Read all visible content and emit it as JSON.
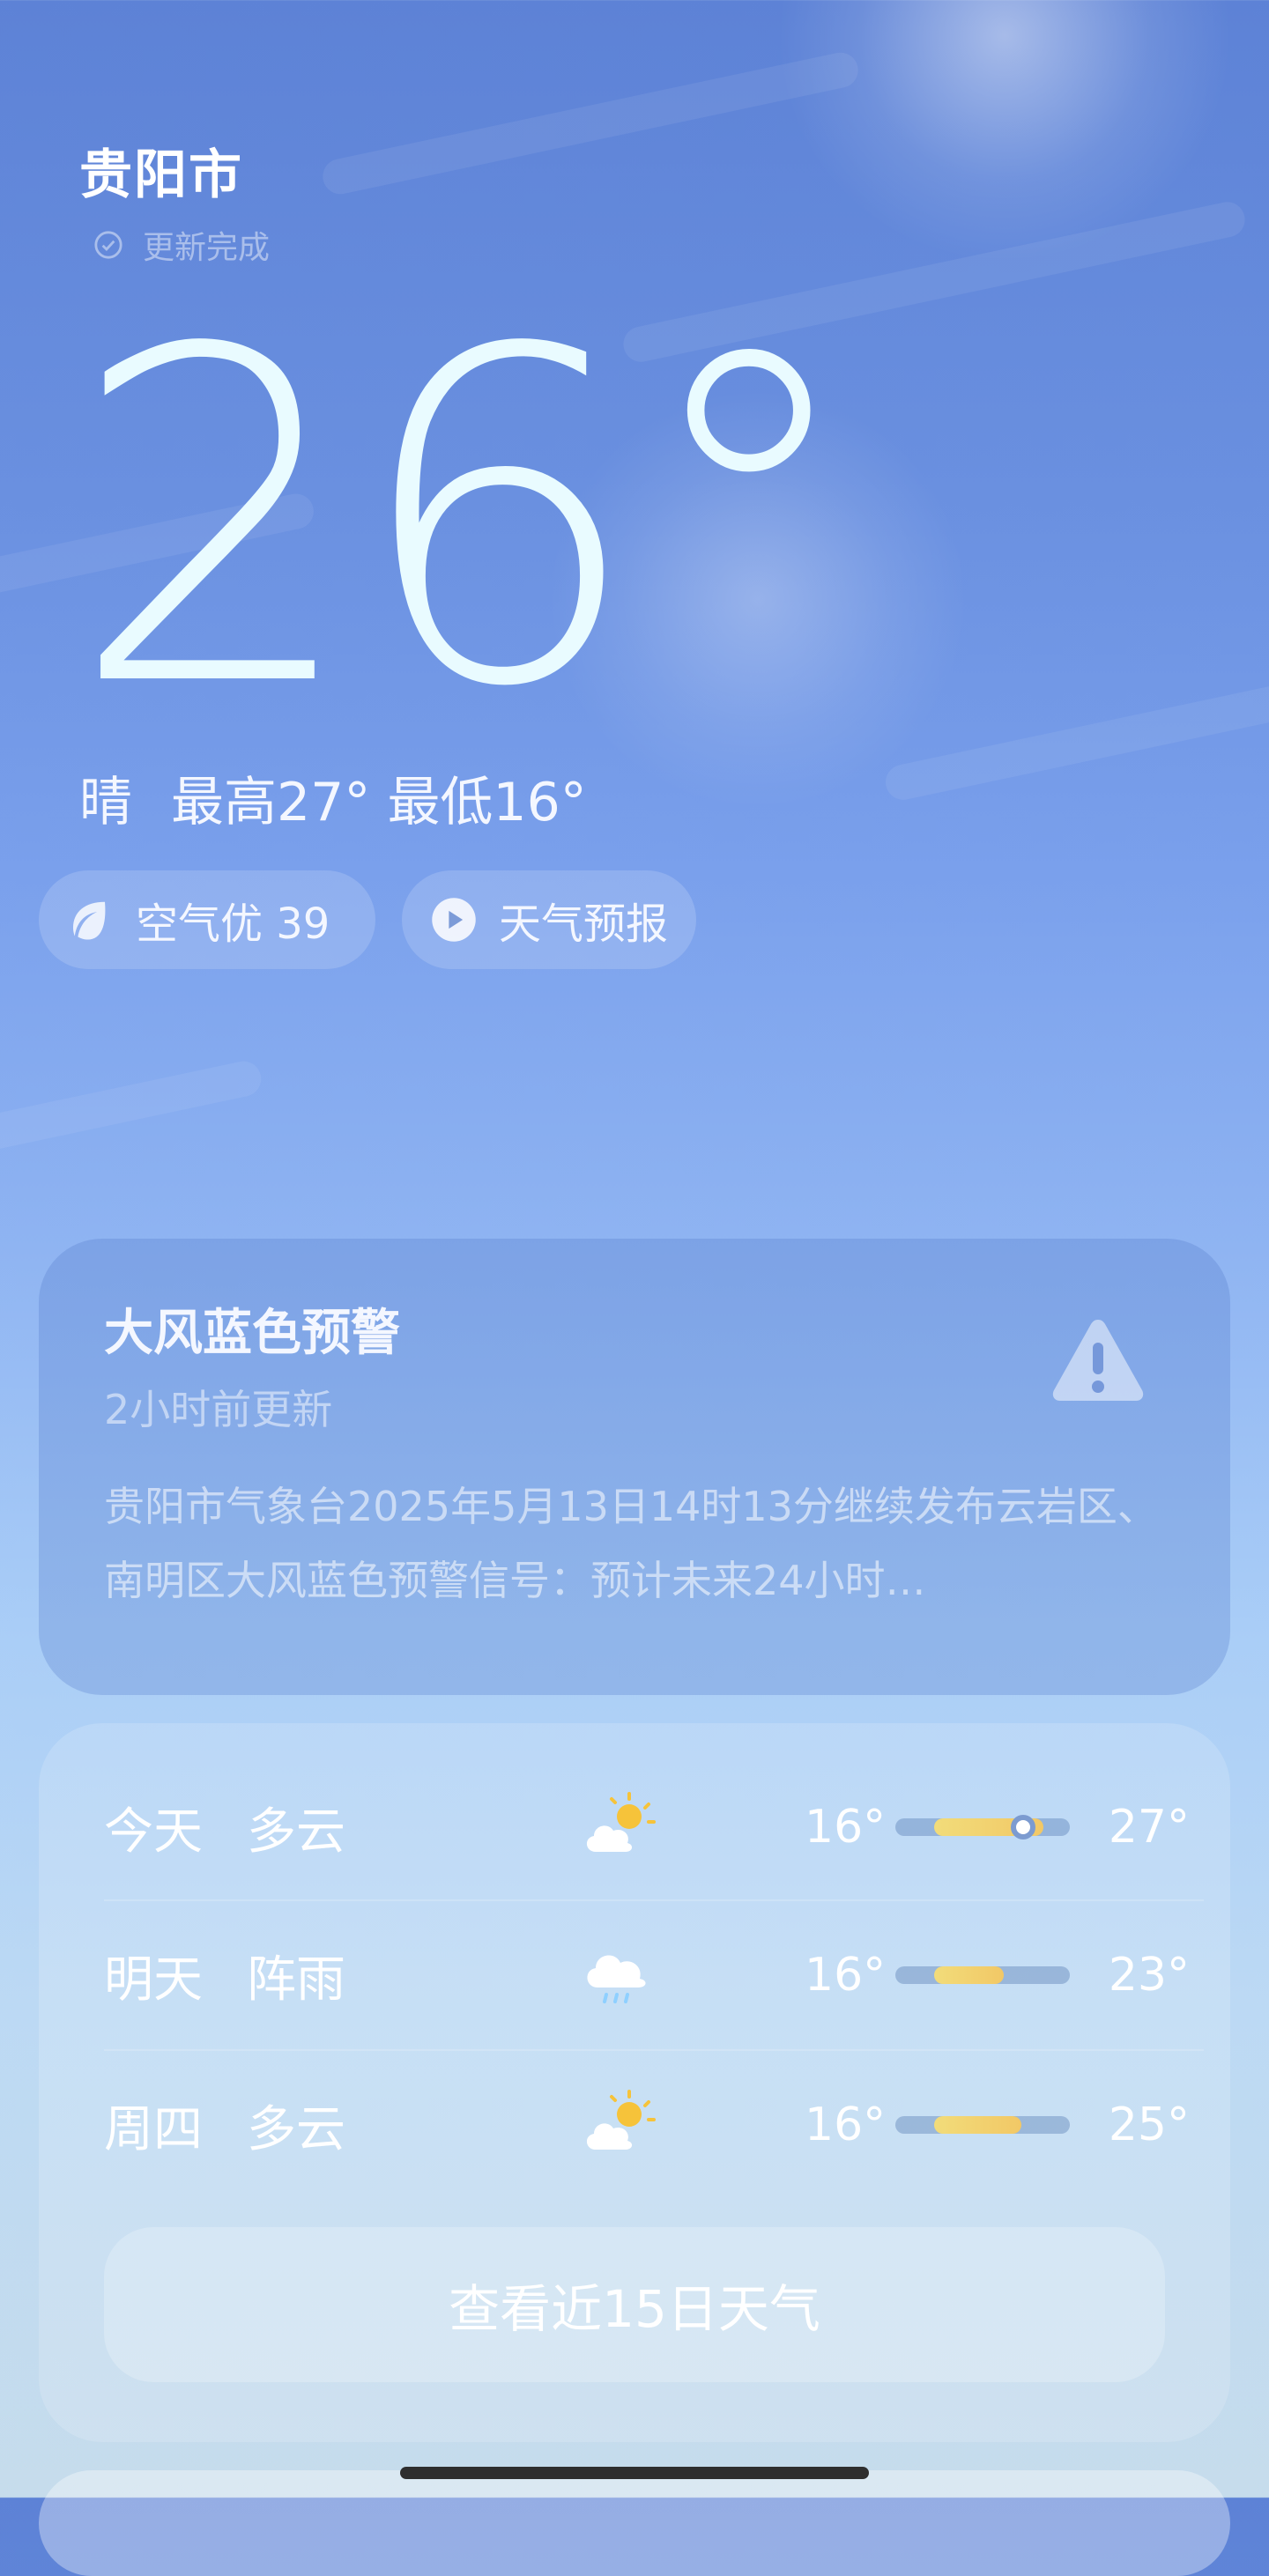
{
  "city": "贵阳市",
  "update_status": "更新完成",
  "current": {
    "temperature": "26°",
    "condition": "晴",
    "high": "最高27°",
    "low": "最低16°"
  },
  "pills": {
    "air_quality": "空气优 39",
    "forecast_video": "天气预报"
  },
  "alert": {
    "title": "大风蓝色预警",
    "time": "2小时前更新",
    "body": "贵阳市气象台2025年5月13日14时13分继续发布云岩区、南明区大风蓝色预警信号：预计未来24小时…",
    "icon": "warning-triangle-icon"
  },
  "forecast": [
    {
      "day": "今天",
      "condition": "多云",
      "icon": "partly-cloudy-icon",
      "low": "16°",
      "high": "27°",
      "range_start": 0.22,
      "range_end": 0.85,
      "current": 0.73
    },
    {
      "day": "明天",
      "condition": "阵雨",
      "icon": "shower-icon",
      "low": "16°",
      "high": "23°",
      "range_start": 0.22,
      "range_end": 0.62
    },
    {
      "day": "周四",
      "condition": "多云",
      "icon": "partly-cloudy-icon",
      "low": "16°",
      "high": "25°",
      "range_start": 0.22,
      "range_end": 0.72
    }
  ],
  "more_button": "查看近15日天气",
  "colors": {
    "bar_fill": "#f2d070",
    "sky_top": "#5d82d6",
    "sky_bottom": "#c6dcec"
  }
}
